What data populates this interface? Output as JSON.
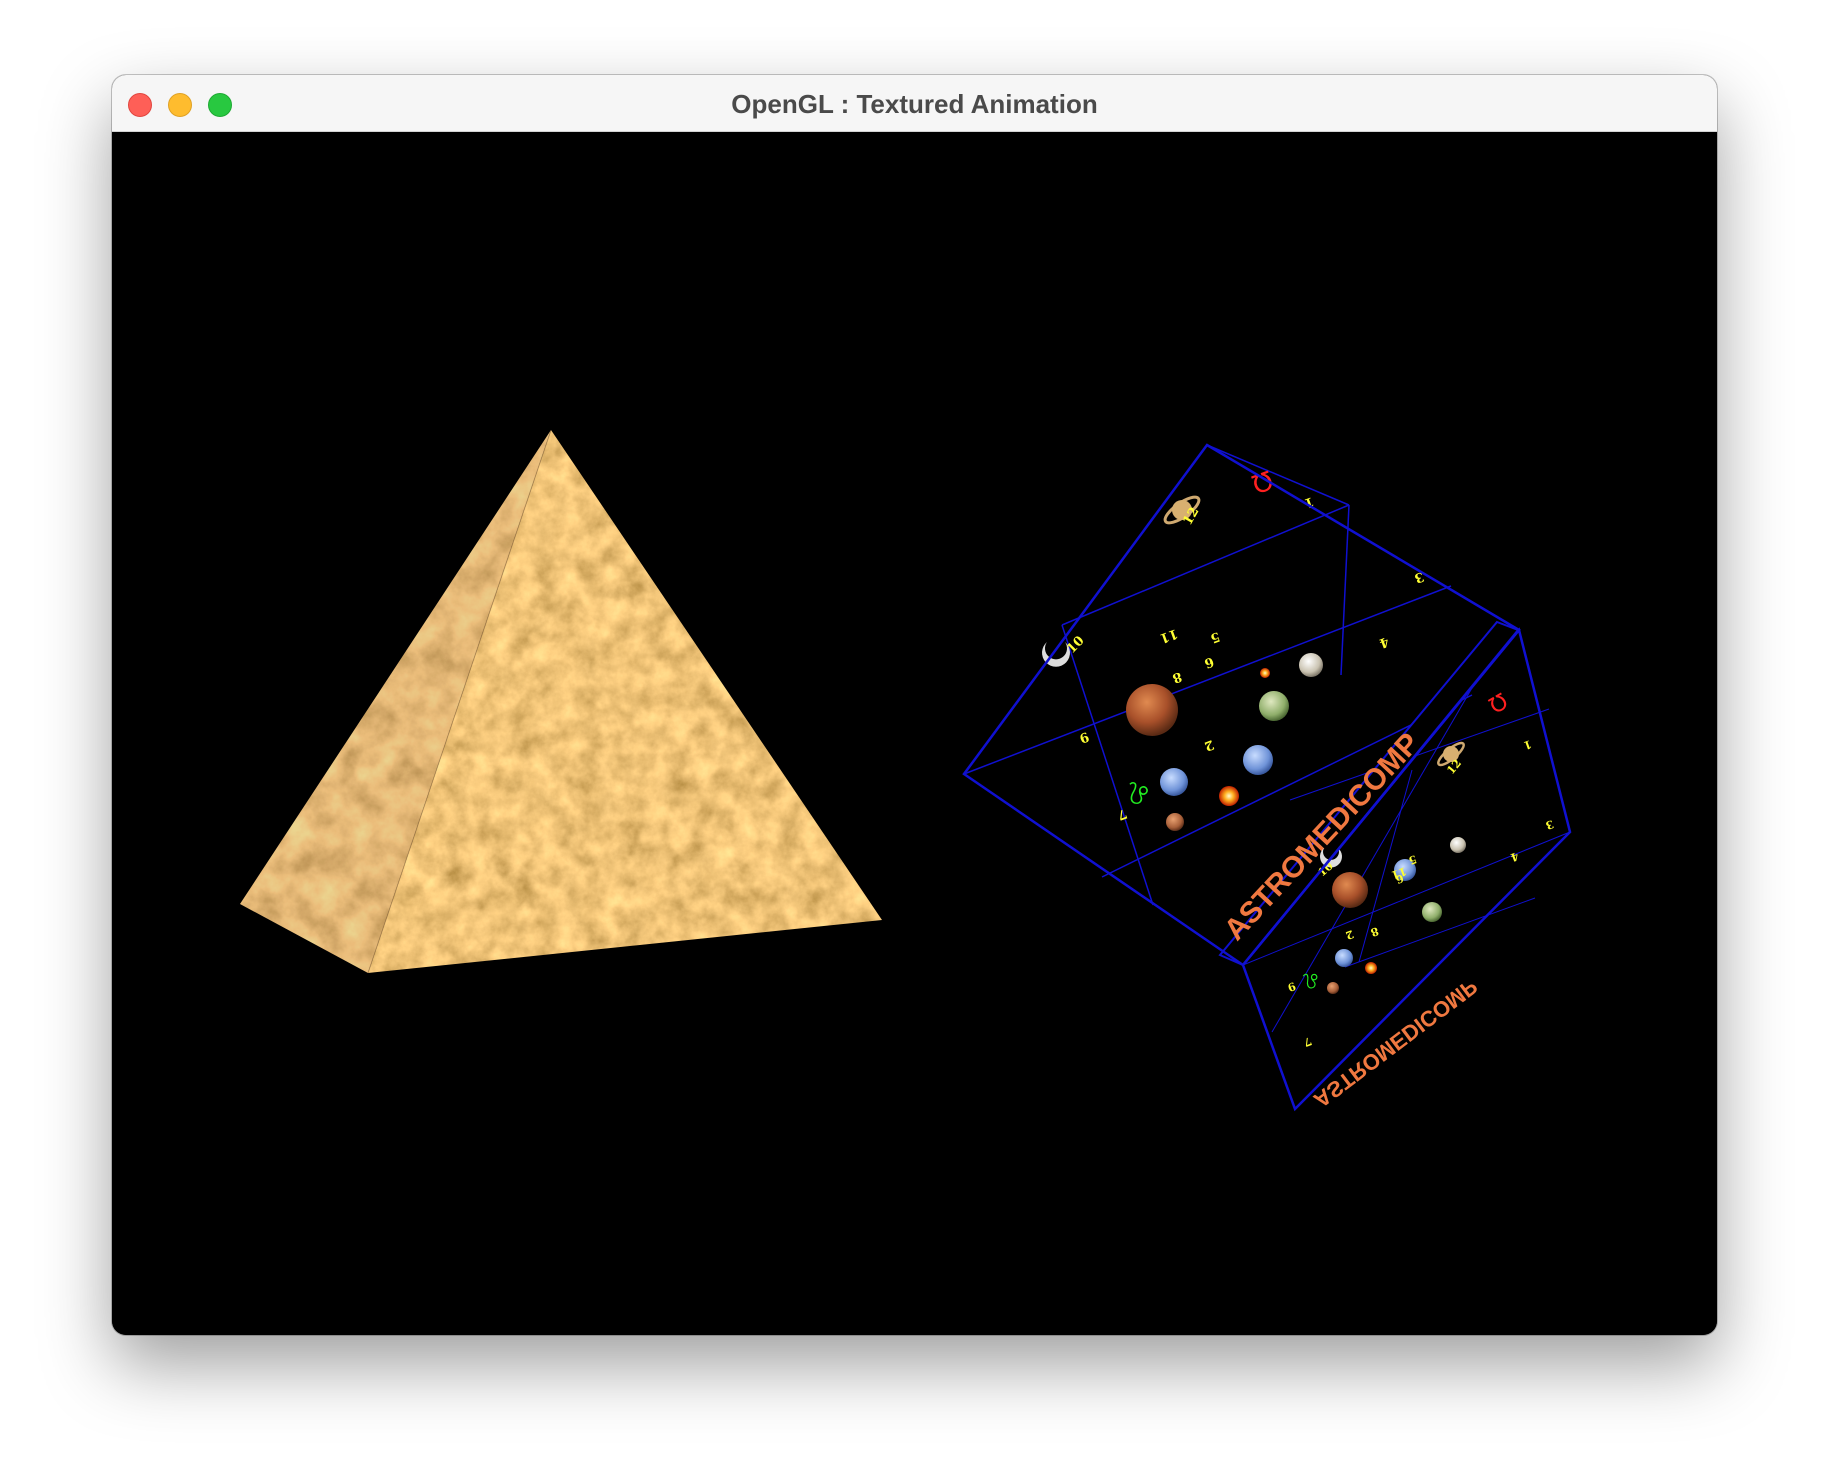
{
  "window": {
    "title": "OpenGL : Textured Animation"
  },
  "scene": {
    "background_color": "#000000",
    "pyramid": {
      "texture": "marble-stone",
      "colors": [
        "#c48a45",
        "#e2b277",
        "#9c6a33",
        "#f0d6a8"
      ]
    },
    "cube": {
      "edge_color": "#1010d0",
      "logo_text": "ASTROMEDICOMP",
      "logo_color": "#f07840",
      "number_color": "#ffff33",
      "top_face_numbers": [
        "1",
        "3",
        "4",
        "5",
        "6",
        "8",
        "10",
        "11",
        "12",
        "7",
        "9",
        "2"
      ],
      "front_face_numbers": [
        "1",
        "3",
        "4",
        "5",
        "6",
        "8",
        "10",
        "11",
        "12",
        "7",
        "9",
        "2"
      ],
      "glyph_leo": "♌",
      "glyph_omega": "Ω"
    }
  }
}
